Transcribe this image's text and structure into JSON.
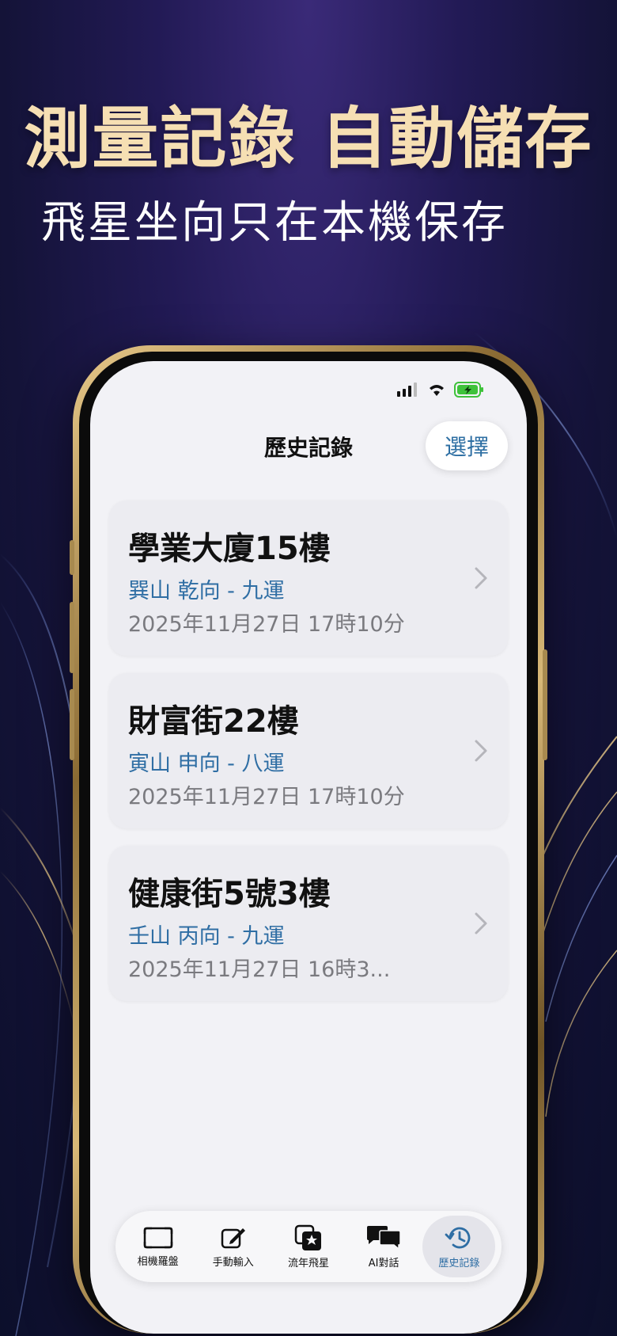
{
  "promo": {
    "headline": "測量記錄  自動儲存",
    "subline": "飛星坐向只在本機保存"
  },
  "screen": {
    "nav_title": "歷史記錄",
    "select_label": "選擇"
  },
  "records": [
    {
      "title": "學業大廈15樓",
      "subtitle": "巽山 乾向 - 九運",
      "date": "2025年11月27日 17時10分"
    },
    {
      "title": "財富街22樓",
      "subtitle": "寅山 申向 - 八運",
      "date": "2025年11月27日 17時10分"
    },
    {
      "title": "健康街5號3樓",
      "subtitle": "壬山 丙向 - 九運",
      "date": "2025年11月27日 16時3..."
    }
  ],
  "tabs": [
    {
      "label": "相機羅盤",
      "icon": "camera-frame-icon"
    },
    {
      "label": "手動輸入",
      "icon": "edit-icon"
    },
    {
      "label": "流年飛星",
      "icon": "star-cards-icon"
    },
    {
      "label": "AI對話",
      "icon": "chat-bubbles-icon"
    },
    {
      "label": "歷史記錄",
      "icon": "history-icon",
      "active": true
    }
  ],
  "colors": {
    "accent": "#2f6ea4",
    "headline": "#f6dfb3",
    "battery": "#3ec23a"
  }
}
